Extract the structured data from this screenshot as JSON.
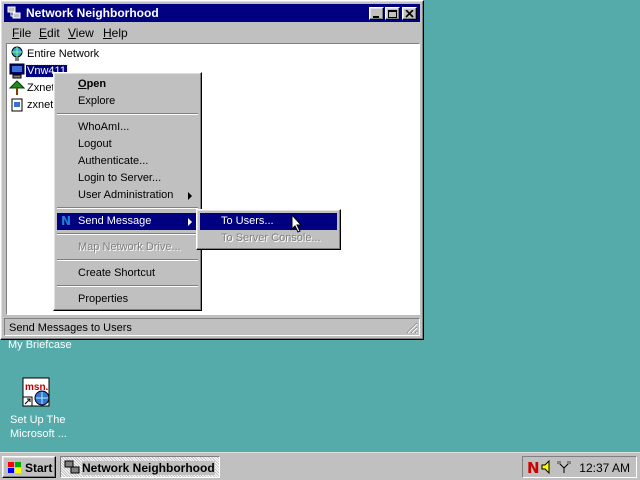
{
  "window": {
    "title": "Network Neighborhood",
    "menus": [
      {
        "label": "File",
        "key": "F",
        "rest": "ile"
      },
      {
        "label": "Edit",
        "key": "E",
        "rest": "dit"
      },
      {
        "label": "View",
        "key": "V",
        "rest": "iew"
      },
      {
        "label": "Help",
        "key": "H",
        "rest": "elp"
      }
    ],
    "items": [
      {
        "label": "Entire Network",
        "icon": "globe-network-icon"
      },
      {
        "label": "Vnw411",
        "icon": "computer-icon",
        "selected": true
      },
      {
        "label": "Zxnet",
        "icon": "tree-icon"
      },
      {
        "label": "zxnet",
        "icon": "server-icon"
      }
    ],
    "status": "Send Messages to Users"
  },
  "context_menu": {
    "items": [
      {
        "id": "open",
        "label": "Open",
        "bold": true
      },
      {
        "id": "explore",
        "label": "Explore"
      },
      {
        "id": "whoami",
        "label": "WhoAmI..."
      },
      {
        "id": "logout",
        "label": "Logout"
      },
      {
        "id": "authenticate",
        "label": "Authenticate..."
      },
      {
        "id": "login",
        "label": "Login to Server..."
      },
      {
        "id": "user-admin",
        "label": "User Administration"
      },
      {
        "id": "send-message",
        "label": "Send Message"
      },
      {
        "id": "map-drive",
        "label": "Map Network Drive..."
      },
      {
        "id": "create-shortcut",
        "label": "Create Shortcut"
      },
      {
        "id": "properties",
        "label": "Properties"
      }
    ]
  },
  "submenu": {
    "items": [
      {
        "label": "To Users..."
      },
      {
        "label": "To Server Console..."
      }
    ]
  },
  "desktop": {
    "briefcase_label": "My Briefcase",
    "msn_line1": "Set Up The",
    "msn_line2": "Microsoft ...",
    "msn_text": "msn."
  },
  "taskbar": {
    "start_label": "Start",
    "task_label": "Network Neighborhood",
    "clock": "12:37 AM"
  },
  "colors": {
    "desktop": "#55aaaa",
    "titlebar": "#000080",
    "selection": "#000080",
    "face": "#c0c0c0"
  }
}
